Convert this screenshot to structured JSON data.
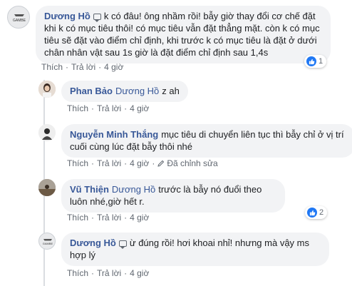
{
  "comments": [
    {
      "author": "Dương Hồ",
      "text": "k có đâu! ông nhầm rồi! bẫy giờ thay đổi cơ chế đặt khi k có mục tiêu thôi! có mục tiêu vẫn đặt thẳng mặt. còn k có mục tiêu sẽ đặt vào điểm chỉ định, khi trước k có mục tiêu là đặt ở dưới chân nhân vật sau 1s giờ là đặt điểm chỉ định sau 1,4s",
      "avatar_label": "GAMBE",
      "like": "Thích",
      "reply": "Trả lời",
      "time": "4 giờ",
      "reaction_count": "1"
    },
    {
      "author": "Phan Bảo",
      "mention": "Dương Hồ",
      "text": "z ah",
      "like": "Thích",
      "reply": "Trả lời",
      "time": "4 giờ"
    },
    {
      "author": "Nguyễn Minh Thắng",
      "text": "mục tiêu di chuyển liên tục thì bẫy chỉ ở vị trí cuối cùng lúc đặt bẫy thôi nhé",
      "like": "Thích",
      "reply": "Trả lời",
      "time": "4 giờ",
      "edited": "Đã chỉnh sửa"
    },
    {
      "author": "Vũ Thiện",
      "mention": "Dương Hồ",
      "text": "trước là bẫy nó đuổi theo luôn nhé,giờ hết r.",
      "like": "Thích",
      "reply": "Trả lời",
      "time": "4 giờ",
      "reaction_count": "2"
    },
    {
      "author": "Dương Hồ",
      "text": "ừ đúng rồi! hơi khoai nhỉ! nhưng mà vậy ms hợp lý",
      "avatar_label": "GAMBE",
      "like": "Thích",
      "reply": "Trả lời",
      "time": "4 giờ"
    }
  ],
  "colors": {
    "link": "#385898",
    "bubble": "#f2f3f5",
    "meta": "#606770",
    "like_blue": "#2078f4"
  },
  "icons": [
    "chat-icon",
    "like-reaction-icon",
    "edit-icon"
  ]
}
